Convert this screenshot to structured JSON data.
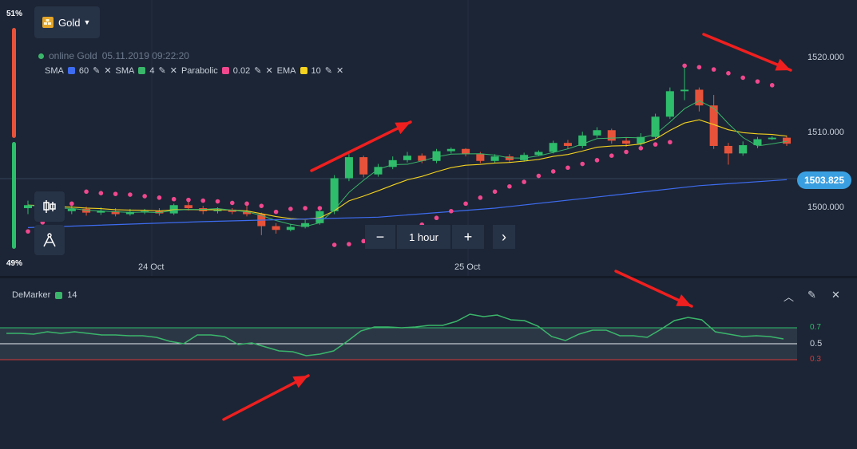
{
  "header": {
    "asset_label": "Gold",
    "online_text": "online Gold",
    "datetime": "05.11.2019 09:22:20"
  },
  "sentiment": {
    "top_pct": "51%",
    "bottom_pct": "49%",
    "up_color": "#e7533a",
    "down_color": "#2ebd6b"
  },
  "indicators": [
    {
      "name": "SMA",
      "param": "60",
      "color": "#3d6cf0"
    },
    {
      "name": "SMA",
      "param": "4",
      "color": "#3ab66a"
    },
    {
      "name": "Parabolic",
      "param": "0.02",
      "color": "#f0488e"
    },
    {
      "name": "EMA",
      "param": "10",
      "color": "#f4d21f"
    }
  ],
  "timeframe": {
    "label": "1 hour",
    "minus": "−",
    "plus": "+",
    "next": "›"
  },
  "price_axis": [
    "1520.000",
    "1510.000",
    "1500.000"
  ],
  "current_price": "1503.825",
  "date_labels": [
    "24 Oct",
    "25 Oct"
  ],
  "demarker": {
    "title": "DeMarker",
    "period": "14",
    "color": "#3ab66a",
    "levels": [
      "0.7",
      "0.5",
      "0.3"
    ],
    "values": [
      0.63,
      0.63,
      0.62,
      0.65,
      0.63,
      0.65,
      0.63,
      0.61,
      0.61,
      0.6,
      0.6,
      0.58,
      0.53,
      0.5,
      0.61,
      0.61,
      0.59,
      0.49,
      0.51,
      0.46,
      0.41,
      0.4,
      0.35,
      0.37,
      0.41,
      0.53,
      0.66,
      0.71,
      0.71,
      0.7,
      0.71,
      0.73,
      0.73,
      0.78,
      0.87,
      0.84,
      0.86,
      0.8,
      0.79,
      0.72,
      0.59,
      0.54,
      0.62,
      0.67,
      0.67,
      0.6,
      0.6,
      0.58,
      0.68,
      0.79,
      0.83,
      0.8,
      0.65,
      0.62,
      0.59,
      0.6,
      0.59,
      0.56
    ]
  },
  "chart_data": {
    "type": "candlestick",
    "y_range": [
      1494,
      1522
    ],
    "candles": [
      [
        1500.0,
        1500.4,
        1501.0,
        1499.2
      ],
      [
        1500.4,
        1500.0,
        1500.9,
        1499.6
      ],
      [
        1500.0,
        1499.6,
        1500.4,
        1498.8
      ],
      [
        1499.6,
        1499.9,
        1500.3,
        1499.2
      ],
      [
        1499.9,
        1499.4,
        1500.2,
        1499.0
      ],
      [
        1499.4,
        1499.6,
        1500.1,
        1499.1
      ],
      [
        1499.6,
        1499.2,
        1500.0,
        1498.9
      ],
      [
        1499.2,
        1499.5,
        1499.9,
        1499.0
      ],
      [
        1499.5,
        1499.6,
        1499.9,
        1499.2
      ],
      [
        1499.6,
        1499.3,
        1500.0,
        1499.0
      ],
      [
        1499.3,
        1500.4,
        1500.6,
        1499.1
      ],
      [
        1500.4,
        1500.0,
        1500.8,
        1499.7
      ],
      [
        1500.0,
        1499.6,
        1500.3,
        1499.2
      ],
      [
        1499.6,
        1499.8,
        1500.1,
        1499.3
      ],
      [
        1499.8,
        1499.5,
        1500.0,
        1499.2
      ],
      [
        1499.5,
        1499.2,
        1500.6,
        1498.9
      ],
      [
        1499.2,
        1497.6,
        1499.4,
        1496.4
      ],
      [
        1497.6,
        1497.1,
        1498.0,
        1496.6
      ],
      [
        1497.1,
        1497.5,
        1497.9,
        1496.9
      ],
      [
        1497.5,
        1498.0,
        1498.4,
        1497.3
      ],
      [
        1498.0,
        1499.6,
        1499.9,
        1497.8
      ],
      [
        1499.6,
        1504.0,
        1504.4,
        1499.2
      ],
      [
        1504.0,
        1506.8,
        1507.2,
        1503.6
      ],
      [
        1506.8,
        1504.5,
        1507.0,
        1504.1
      ],
      [
        1504.5,
        1505.5,
        1505.9,
        1504.2
      ],
      [
        1505.5,
        1506.4,
        1506.9,
        1505.2
      ],
      [
        1506.4,
        1507.0,
        1507.5,
        1506.1
      ],
      [
        1507.0,
        1506.3,
        1507.3,
        1506.0
      ],
      [
        1506.3,
        1507.6,
        1507.9,
        1506.0
      ],
      [
        1507.6,
        1507.9,
        1508.1,
        1507.3
      ],
      [
        1507.9,
        1507.2,
        1508.0,
        1506.9
      ],
      [
        1507.2,
        1506.3,
        1507.5,
        1506.0
      ],
      [
        1506.3,
        1506.9,
        1507.2,
        1506.0
      ],
      [
        1506.9,
        1506.4,
        1507.2,
        1506.1
      ],
      [
        1506.4,
        1507.1,
        1507.4,
        1506.2
      ],
      [
        1507.1,
        1507.5,
        1507.7,
        1507.0
      ],
      [
        1507.5,
        1508.7,
        1509.0,
        1507.3
      ],
      [
        1508.7,
        1508.3,
        1509.1,
        1507.9
      ],
      [
        1508.3,
        1509.7,
        1510.2,
        1508.0
      ],
      [
        1509.7,
        1510.4,
        1510.8,
        1509.4
      ],
      [
        1510.4,
        1509.0,
        1510.6,
        1508.6
      ],
      [
        1509.0,
        1508.6,
        1509.4,
        1508.2
      ],
      [
        1508.6,
        1509.5,
        1510.0,
        1508.3
      ],
      [
        1509.5,
        1512.2,
        1512.6,
        1509.2
      ],
      [
        1512.2,
        1515.6,
        1516.1,
        1511.9
      ],
      [
        1515.6,
        1515.8,
        1519.0,
        1514.4
      ],
      [
        1515.8,
        1513.7,
        1516.1,
        1512.9
      ],
      [
        1513.7,
        1508.3,
        1515.1,
        1507.9
      ],
      [
        1508.3,
        1507.3,
        1508.7,
        1505.8
      ],
      [
        1507.3,
        1508.4,
        1508.9,
        1507.0
      ],
      [
        1508.4,
        1509.2,
        1509.5,
        1508.0
      ],
      [
        1509.2,
        1509.4,
        1509.6,
        1509.1
      ],
      [
        1509.4,
        1508.6,
        1509.7,
        1508.3
      ]
    ],
    "sma60": [
      [
        0,
        1497.4
      ],
      [
        12,
        1498.2
      ],
      [
        24,
        1498.8
      ],
      [
        32,
        1500.0
      ],
      [
        40,
        1501.7
      ],
      [
        46,
        1503.0
      ],
      [
        52,
        1503.8
      ]
    ],
    "parabolic": [
      1496.9,
      1498.1,
      1499.6,
      1500.6,
      1502.2,
      1502.0,
      1501.9,
      1501.8,
      1501.6,
      1501.4,
      1501.2,
      1501.1,
      1501.0,
      1500.9,
      1500.7,
      1500.6,
      1500.3,
      1499.5,
      1499.9,
      1500.0,
      1500.0,
      1495.1,
      1495.2,
      1495.6,
      1496.3,
      1496.6,
      1497.2,
      1497.8,
      1498.7,
      1499.6,
      1500.6,
      1501.4,
      1502.2,
      1502.9,
      1503.5,
      1504.3,
      1504.9,
      1505.4,
      1505.9,
      1506.4,
      1507.0,
      1507.5,
      1508.0,
      1508.5,
      1508.8,
      1519.0,
      1518.8,
      1518.5,
      1518.0,
      1517.4,
      1516.9,
      1516.4
    ],
    "price_labels": [
      "1520.000",
      "1510.000",
      "1500.000"
    ],
    "current": 1503.825
  }
}
